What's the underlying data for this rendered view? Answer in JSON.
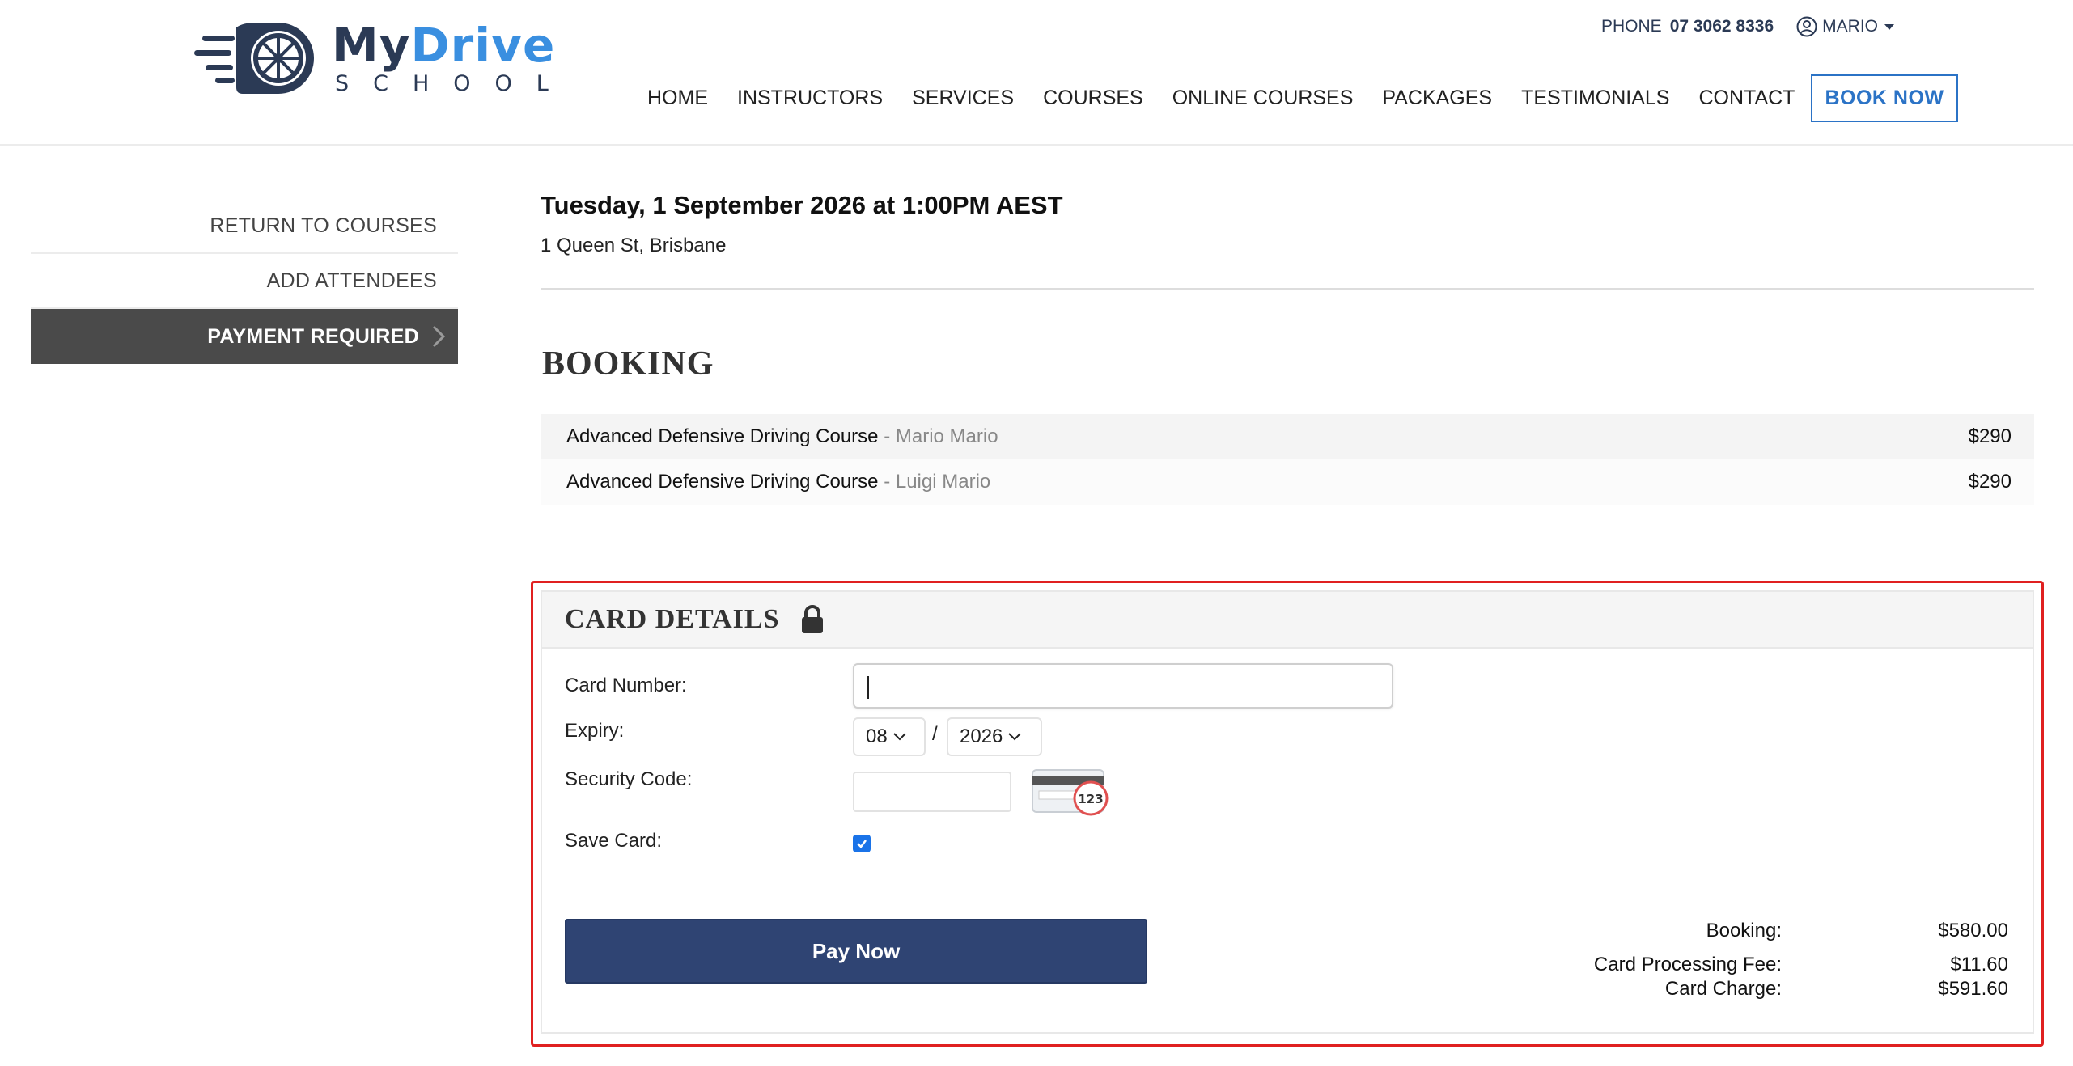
{
  "brand": {
    "name_part1": "My",
    "name_part2": "Drive",
    "tagline": "SCHOOL",
    "colors": {
      "navy": "#2b3a55",
      "blue": "#2b73c6",
      "button": "#2f4473",
      "highlight": "#e02020"
    }
  },
  "header": {
    "phone_label": "PHONE",
    "phone_number": "07 3062 8336",
    "user_name": "MARIO",
    "nav": [
      "HOME",
      "INSTRUCTORS",
      "SERVICES",
      "COURSES",
      "ONLINE COURSES",
      "PACKAGES",
      "TESTIMONIALS",
      "CONTACT"
    ],
    "book_now": "BOOK NOW"
  },
  "sidebar": {
    "items": [
      {
        "label": "RETURN TO COURSES",
        "active": false
      },
      {
        "label": "ADD ATTENDEES",
        "active": false
      },
      {
        "label": "PAYMENT REQUIRED",
        "active": true
      }
    ]
  },
  "event": {
    "date": "Tuesday, 1 September 2026 at 1:00PM AEST",
    "location": "1 Queen St, Brisbane"
  },
  "booking": {
    "title": "BOOKING",
    "rows": [
      {
        "course": "Advanced Defensive Driving Course",
        "attendee": " - Mario Mario",
        "price": "$290"
      },
      {
        "course": "Advanced Defensive Driving Course",
        "attendee": " - Luigi Mario",
        "price": "$290"
      }
    ]
  },
  "card": {
    "title": "CARD DETAILS",
    "card_number_label": "Card Number:",
    "card_number_value": "",
    "expiry_label": "Expiry:",
    "expiry_month": "08",
    "expiry_year": "2026",
    "expiry_separator": "/",
    "security_label": "Security Code:",
    "security_value": "",
    "cvv_hint": "123",
    "save_label": "Save Card:",
    "save_checked": true,
    "pay_button": "Pay Now",
    "totals": [
      {
        "label": "Booking:",
        "value": "$580.00"
      },
      {
        "label": "Card Processing Fee:",
        "value": "$11.60"
      },
      {
        "label": "Card Charge:",
        "value": "$591.60"
      }
    ]
  }
}
